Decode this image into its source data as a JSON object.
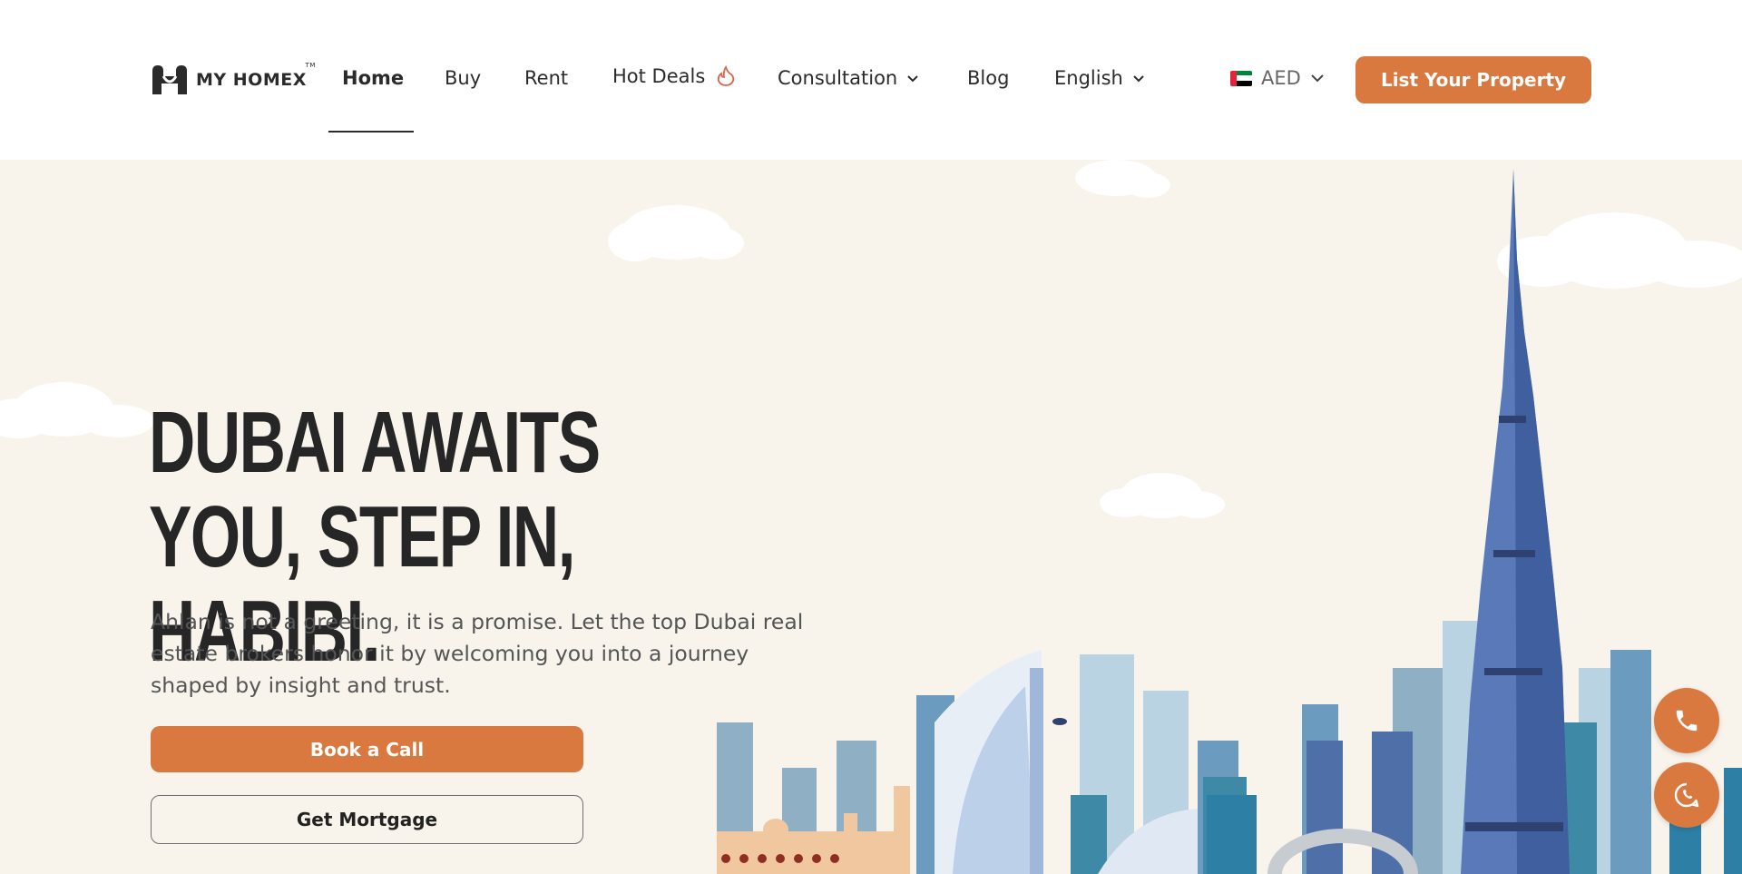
{
  "brand": {
    "name": "MY HOMEX",
    "tm": "TM"
  },
  "nav": {
    "items": [
      {
        "label": "Home"
      },
      {
        "label": "Buy"
      },
      {
        "label": "Rent"
      },
      {
        "label": "Hot Deals"
      },
      {
        "label": "Consultation"
      },
      {
        "label": "Blog"
      },
      {
        "label": "English"
      }
    ],
    "active": "Home"
  },
  "currency": {
    "value": "AED",
    "flag": "uae-flag-icon"
  },
  "cta": {
    "list_property": "List Your Property"
  },
  "hero": {
    "title": "DUBAI AWAITS YOU, STEP IN, HABIBI.",
    "subtitle": "Ahlan is not a greeting, it is a promise. Let the top Dubai real estate brokers honor it by welcoming you into a journey shaped by insight and trust.",
    "book_call": "Book a Call",
    "get_mortgage": "Get Mortgage"
  },
  "floating": {
    "phone": "phone-icon",
    "whatsapp": "whatsapp-icon"
  },
  "colors": {
    "accent": "#d9793f",
    "hero_bg": "#f8f4ec",
    "text": "#2b2b2b"
  }
}
